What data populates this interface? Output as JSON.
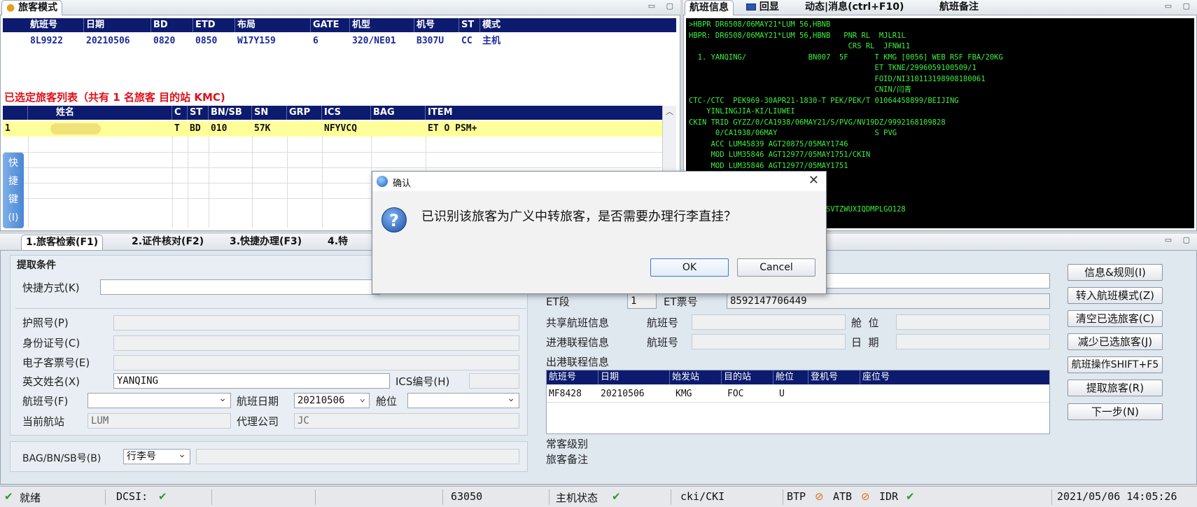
{
  "top_left": {
    "title": "旅客模式",
    "flight_table": {
      "headers": [
        "航班号",
        "日期",
        "BD",
        "ETD",
        "布局",
        "GATE",
        "机型",
        "机号",
        "ST",
        "模式"
      ],
      "row": [
        "8L9922",
        "20210506",
        "0820",
        "0850",
        "W17Y159",
        "6",
        "320/NE01",
        "B307U",
        "CC",
        "主机"
      ]
    },
    "selected_title": "已选定旅客列表（共有 1  名旅客 目的站 KMC)",
    "pax_table": {
      "headers": [
        "",
        "姓名",
        "C",
        "ST",
        "BN/SB",
        "SN",
        "GRP",
        "ICS",
        "BAG",
        "ITEM"
      ],
      "row": [
        "1",
        "",
        "T",
        "BD",
        "010",
        "57K",
        "",
        "NFYVCQ",
        "",
        "ET O PSM+"
      ]
    },
    "side_tab": [
      "快",
      "捷",
      "键",
      "(I)"
    ]
  },
  "top_right": {
    "tabs": [
      "航班信息",
      "回显",
      "动态|消息(ctrl+F10)",
      "航班备注"
    ],
    "terminal": ">HBPR DR6508/06MAY21*LUM 56,HBNB\nHBPR: DR6508/06MAY21*LUM 56,HBNB   PNR RL  MJLR1L\n                                    CRS RL  JFNW11\n  1. YANQING/              BN007  5F      T KMG [0056] WEB RSF FBA/20KG\n                                          ET TKNE/2996059100509/1\n                                          FOID/NI310113198908180061\n                                          CNIN/闫青\nCTC-/CTC  PEK969-30APR21-1830-T PEK/PEK/T 01064458899/BEIJING\n    YINLINGJIA-KI/LIUWEI\nCKIN TRID GYZZ/0/CA1938/06MAY21/S/PVG/NV19DZ/9992168109828\n      0/CA1938/06MAY                      S PVG\n     ACC LUM45839 AGT20875/05MAY1746\n     MOD LUM35846 AGT12977/05MAY1751/CKIN\n     MOD LUM35846 AGT12977/05MAY1751\n\n\n\n                             NRSVTZWUXIQDMPLGO128"
  },
  "bottom": {
    "tabs": [
      "1.旅客检索(F1)",
      "2.证件核对(F2)",
      "3.快捷办理(F3)",
      "4.特"
    ],
    "section_title": "提取条件",
    "labels": {
      "quick": "快捷方式(K)",
      "passport": "护照号(P)",
      "idcard": "身份证号(C)",
      "eticket": "电子客票号(E)",
      "english_name": "英文姓名(X)",
      "ics": "ICS编号(H)",
      "flight_no": "航班号(F)",
      "flight_date": "航班日期",
      "cabin": "舱位",
      "station": "当前航站",
      "agent": "代理公司",
      "bag": "BAG/BN/SB号(B)"
    },
    "values": {
      "english_name": "YANQING",
      "flight_date": "20210506",
      "station": "LUM",
      "agent": "JC",
      "bag_type": "行李号"
    }
  },
  "right_info": {
    "et_seg_label": "ET段",
    "et_seg_value": "1",
    "et_ticket_label": "ET票号",
    "et_ticket_value": "8592147706449",
    "share_label": "共享航班信息",
    "inbound_label": "进港联程信息",
    "flight_no_label": "航班号",
    "cabin_label": "舱  位",
    "date_label": "日  期",
    "outbound_label": "出港联程信息",
    "conn_headers": [
      "航班号",
      "日期",
      "始发站",
      "目的站",
      "舱位",
      "登机号",
      "座位号"
    ],
    "conn_row": [
      "MF8428",
      "20210506",
      "KMG",
      "FOC",
      "U",
      "",
      ""
    ],
    "ff_level": "常客级别",
    "pax_remark": "旅客备注"
  },
  "buttons": [
    "信息&规则(I)",
    "转入航班模式(Z)",
    "清空已选旅客(C)",
    "减少已选旅客(J)",
    "航班操作SHIFT+F5",
    "提取旅客(R)",
    "下一步(N)"
  ],
  "dialog": {
    "title": "确认",
    "message": "已识别该旅客为广义中转旅客，是否需要办理行李直挂？",
    "ok": "OK",
    "cancel": "Cancel"
  },
  "statusbar": {
    "ready": "就绪",
    "dcsi": "DCSI:",
    "code": "63050",
    "host_status": "主机状态",
    "user": "cki/CKI",
    "btp": "BTP",
    "atb": "ATB",
    "idr": "IDR",
    "datetime": "2021/05/06 14:05:26"
  }
}
